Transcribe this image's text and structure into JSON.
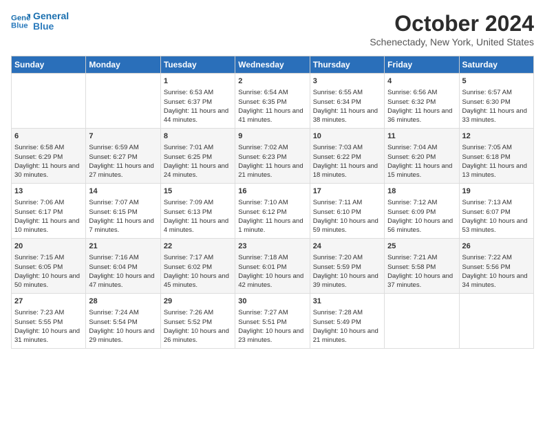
{
  "header": {
    "logo_line1": "General",
    "logo_line2": "Blue",
    "month": "October 2024",
    "location": "Schenectady, New York, United States"
  },
  "weekdays": [
    "Sunday",
    "Monday",
    "Tuesday",
    "Wednesday",
    "Thursday",
    "Friday",
    "Saturday"
  ],
  "weeks": [
    [
      {
        "day": "",
        "info": ""
      },
      {
        "day": "",
        "info": ""
      },
      {
        "day": "1",
        "info": "Sunrise: 6:53 AM\nSunset: 6:37 PM\nDaylight: 11 hours and 44 minutes."
      },
      {
        "day": "2",
        "info": "Sunrise: 6:54 AM\nSunset: 6:35 PM\nDaylight: 11 hours and 41 minutes."
      },
      {
        "day": "3",
        "info": "Sunrise: 6:55 AM\nSunset: 6:34 PM\nDaylight: 11 hours and 38 minutes."
      },
      {
        "day": "4",
        "info": "Sunrise: 6:56 AM\nSunset: 6:32 PM\nDaylight: 11 hours and 36 minutes."
      },
      {
        "day": "5",
        "info": "Sunrise: 6:57 AM\nSunset: 6:30 PM\nDaylight: 11 hours and 33 minutes."
      }
    ],
    [
      {
        "day": "6",
        "info": "Sunrise: 6:58 AM\nSunset: 6:29 PM\nDaylight: 11 hours and 30 minutes."
      },
      {
        "day": "7",
        "info": "Sunrise: 6:59 AM\nSunset: 6:27 PM\nDaylight: 11 hours and 27 minutes."
      },
      {
        "day": "8",
        "info": "Sunrise: 7:01 AM\nSunset: 6:25 PM\nDaylight: 11 hours and 24 minutes."
      },
      {
        "day": "9",
        "info": "Sunrise: 7:02 AM\nSunset: 6:23 PM\nDaylight: 11 hours and 21 minutes."
      },
      {
        "day": "10",
        "info": "Sunrise: 7:03 AM\nSunset: 6:22 PM\nDaylight: 11 hours and 18 minutes."
      },
      {
        "day": "11",
        "info": "Sunrise: 7:04 AM\nSunset: 6:20 PM\nDaylight: 11 hours and 15 minutes."
      },
      {
        "day": "12",
        "info": "Sunrise: 7:05 AM\nSunset: 6:18 PM\nDaylight: 11 hours and 13 minutes."
      }
    ],
    [
      {
        "day": "13",
        "info": "Sunrise: 7:06 AM\nSunset: 6:17 PM\nDaylight: 11 hours and 10 minutes."
      },
      {
        "day": "14",
        "info": "Sunrise: 7:07 AM\nSunset: 6:15 PM\nDaylight: 11 hours and 7 minutes."
      },
      {
        "day": "15",
        "info": "Sunrise: 7:09 AM\nSunset: 6:13 PM\nDaylight: 11 hours and 4 minutes."
      },
      {
        "day": "16",
        "info": "Sunrise: 7:10 AM\nSunset: 6:12 PM\nDaylight: 11 hours and 1 minute."
      },
      {
        "day": "17",
        "info": "Sunrise: 7:11 AM\nSunset: 6:10 PM\nDaylight: 10 hours and 59 minutes."
      },
      {
        "day": "18",
        "info": "Sunrise: 7:12 AM\nSunset: 6:09 PM\nDaylight: 10 hours and 56 minutes."
      },
      {
        "day": "19",
        "info": "Sunrise: 7:13 AM\nSunset: 6:07 PM\nDaylight: 10 hours and 53 minutes."
      }
    ],
    [
      {
        "day": "20",
        "info": "Sunrise: 7:15 AM\nSunset: 6:05 PM\nDaylight: 10 hours and 50 minutes."
      },
      {
        "day": "21",
        "info": "Sunrise: 7:16 AM\nSunset: 6:04 PM\nDaylight: 10 hours and 47 minutes."
      },
      {
        "day": "22",
        "info": "Sunrise: 7:17 AM\nSunset: 6:02 PM\nDaylight: 10 hours and 45 minutes."
      },
      {
        "day": "23",
        "info": "Sunrise: 7:18 AM\nSunset: 6:01 PM\nDaylight: 10 hours and 42 minutes."
      },
      {
        "day": "24",
        "info": "Sunrise: 7:20 AM\nSunset: 5:59 PM\nDaylight: 10 hours and 39 minutes."
      },
      {
        "day": "25",
        "info": "Sunrise: 7:21 AM\nSunset: 5:58 PM\nDaylight: 10 hours and 37 minutes."
      },
      {
        "day": "26",
        "info": "Sunrise: 7:22 AM\nSunset: 5:56 PM\nDaylight: 10 hours and 34 minutes."
      }
    ],
    [
      {
        "day": "27",
        "info": "Sunrise: 7:23 AM\nSunset: 5:55 PM\nDaylight: 10 hours and 31 minutes."
      },
      {
        "day": "28",
        "info": "Sunrise: 7:24 AM\nSunset: 5:54 PM\nDaylight: 10 hours and 29 minutes."
      },
      {
        "day": "29",
        "info": "Sunrise: 7:26 AM\nSunset: 5:52 PM\nDaylight: 10 hours and 26 minutes."
      },
      {
        "day": "30",
        "info": "Sunrise: 7:27 AM\nSunset: 5:51 PM\nDaylight: 10 hours and 23 minutes."
      },
      {
        "day": "31",
        "info": "Sunrise: 7:28 AM\nSunset: 5:49 PM\nDaylight: 10 hours and 21 minutes."
      },
      {
        "day": "",
        "info": ""
      },
      {
        "day": "",
        "info": ""
      }
    ]
  ]
}
